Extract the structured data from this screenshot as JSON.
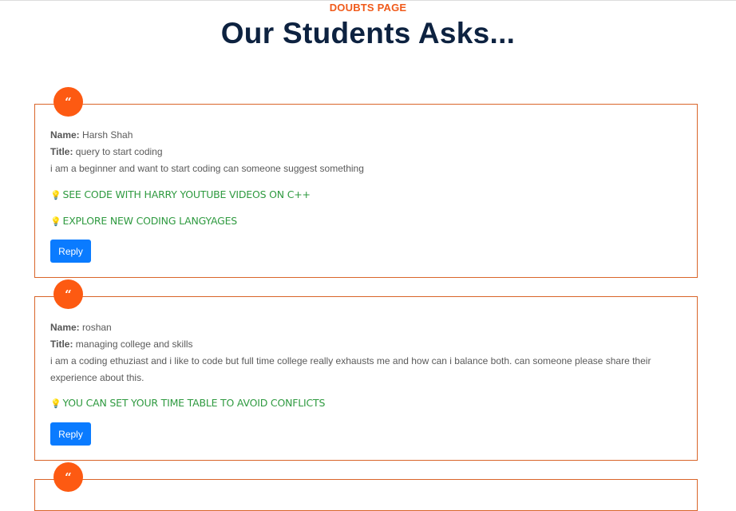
{
  "header": {
    "eyebrow": "DOUBTS PAGE",
    "title": "Our Students Asks..."
  },
  "quote_glyph": "“",
  "bulb_glyph": "💡",
  "labels": {
    "name": "Name:",
    "title": "Title:"
  },
  "reply_label": "Reply",
  "colors": {
    "accent": "#fd5a12",
    "border": "#d9652a",
    "heading": "#0d2240",
    "answer": "#2f9a40",
    "button": "#0a7bff"
  },
  "posts": [
    {
      "name": "Harsh Shah",
      "title": "query to start coding",
      "body": "i am a beginner and want to start coding can someone suggest something",
      "answers": [
        "SEE CODE WITH HARRY YOUTUBE VIDEOS ON C++",
        "EXPLORE NEW CODING LANGYAGES"
      ]
    },
    {
      "name": "roshan",
      "title": "managing college and skills",
      "body": "i am a coding ethuziast and i like to code but full time college really exhausts me and how can i balance both. can someone please share their experience about this.",
      "answers": [
        "YOU CAN SET YOUR TIME TABLE TO AVOID CONFLICTS"
      ]
    }
  ]
}
